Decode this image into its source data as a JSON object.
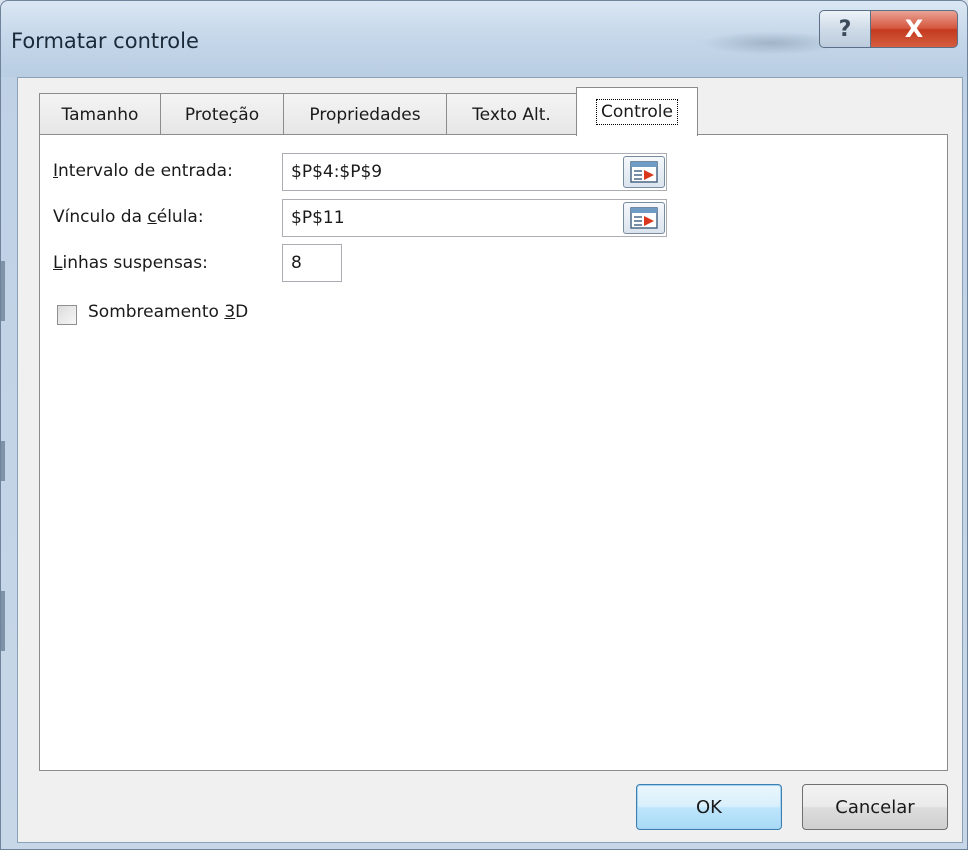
{
  "window": {
    "title": "Formatar controle",
    "help_label": "?",
    "close_label": "X"
  },
  "tabs": [
    {
      "label": "Tamanho",
      "active": false
    },
    {
      "label": "Proteção",
      "active": false
    },
    {
      "label": "Propriedades",
      "active": false
    },
    {
      "label": "Texto Alt.",
      "active": false
    },
    {
      "label": "Controle",
      "active": true
    }
  ],
  "form": {
    "input_range": {
      "label_mnemonic": "I",
      "label_rest": "ntervalo de entrada:",
      "value": "$P$4:$P$9"
    },
    "cell_link": {
      "label_pre": "Vínculo da ",
      "label_mnemonic": "c",
      "label_rest": "élula:",
      "value": "$P$11"
    },
    "dropdown_lines": {
      "label_mnemonic": "L",
      "label_rest": "inhas suspensas:",
      "value": "8"
    },
    "shading_3d": {
      "label_pre": "Sombreamento ",
      "label_mnemonic": "3",
      "label_rest": "D",
      "checked": false
    }
  },
  "buttons": {
    "ok_label": "OK",
    "cancel_label": "Cancelar"
  },
  "icons": {
    "help": "question-icon",
    "close": "close-icon",
    "range_picker": "collapse-dialog-icon"
  },
  "colors": {
    "close_red": "#c33a1f",
    "default_button_border": "#3c7fb1"
  }
}
